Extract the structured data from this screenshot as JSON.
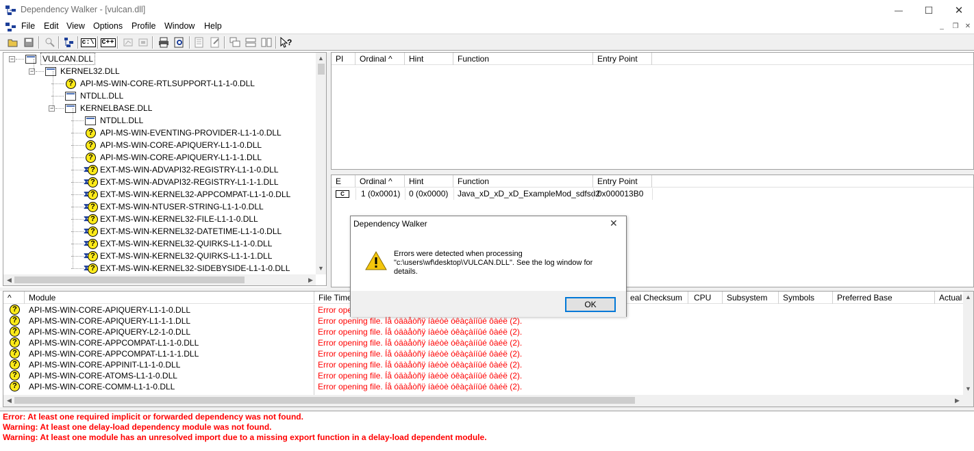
{
  "window": {
    "title": "Dependency Walker - [vulcan.dll]",
    "minimize": "—",
    "maximize": "☐",
    "close": "✕"
  },
  "menu": {
    "items": [
      "File",
      "Edit",
      "View",
      "Options",
      "Profile",
      "Window",
      "Help"
    ],
    "mdi_minimize": "_",
    "mdi_restore": "❐",
    "mdi_close": "✕"
  },
  "toolbar": {
    "c_label": "c:\\",
    "cpp_label": "C++"
  },
  "tree": {
    "items": [
      {
        "label": "VULCAN.DLL",
        "icon": "dll-module-icon",
        "level": 0,
        "selected": true
      },
      {
        "label": "KERNEL32.DLL",
        "icon": "dll-module-icon",
        "level": 1
      },
      {
        "label": "API-MS-WIN-CORE-RTLSUPPORT-L1-1-0.DLL",
        "icon": "missing-module-icon",
        "level": 2
      },
      {
        "label": "NTDLL.DLL",
        "icon": "dll-module-icon",
        "level": 2
      },
      {
        "label": "KERNELBASE.DLL",
        "icon": "dll-module-icon",
        "level": 2
      },
      {
        "label": "NTDLL.DLL",
        "icon": "dll-module-icon",
        "level": 3
      },
      {
        "label": "API-MS-WIN-EVENTING-PROVIDER-L1-1-0.DLL",
        "icon": "missing-module-icon",
        "level": 3
      },
      {
        "label": "API-MS-WIN-CORE-APIQUERY-L1-1-0.DLL",
        "icon": "missing-module-icon",
        "level": 3
      },
      {
        "label": "API-MS-WIN-CORE-APIQUERY-L1-1-1.DLL",
        "icon": "missing-module-icon",
        "level": 3
      },
      {
        "label": "EXT-MS-WIN-ADVAPI32-REGISTRY-L1-1-0.DLL",
        "icon": "delay-load-missing-icon",
        "level": 3
      },
      {
        "label": "EXT-MS-WIN-ADVAPI32-REGISTRY-L1-1-1.DLL",
        "icon": "delay-load-missing-icon",
        "level": 3
      },
      {
        "label": "EXT-MS-WIN-KERNEL32-APPCOMPAT-L1-1-0.DLL",
        "icon": "delay-load-missing-icon",
        "level": 3
      },
      {
        "label": "EXT-MS-WIN-NTUSER-STRING-L1-1-0.DLL",
        "icon": "delay-load-missing-icon",
        "level": 3
      },
      {
        "label": "EXT-MS-WIN-KERNEL32-FILE-L1-1-0.DLL",
        "icon": "delay-load-missing-icon",
        "level": 3
      },
      {
        "label": "EXT-MS-WIN-KERNEL32-DATETIME-L1-1-0.DLL",
        "icon": "delay-load-missing-icon",
        "level": 3
      },
      {
        "label": "EXT-MS-WIN-KERNEL32-QUIRKS-L1-1-0.DLL",
        "icon": "delay-load-missing-icon",
        "level": 3
      },
      {
        "label": "EXT-MS-WIN-KERNEL32-QUIRKS-L1-1-1.DLL",
        "icon": "delay-load-missing-icon",
        "level": 3
      },
      {
        "label": "EXT-MS-WIN-KERNEL32-SIDEBYSIDE-L1-1-0.DLL",
        "icon": "delay-load-missing-icon",
        "level": 3
      }
    ]
  },
  "imports_table": {
    "columns": [
      "PI",
      "Ordinal ^",
      "Hint",
      "Function",
      "Entry Point"
    ]
  },
  "exports_table": {
    "columns": [
      "E",
      "Ordinal ^",
      "Hint",
      "Function",
      "Entry Point"
    ],
    "rows": [
      {
        "icon": "C",
        "ordinal": "1 (0x0001)",
        "hint": "0 (0x0000)",
        "function": "Java_xD_xD_xD_ExampleMod_sdfsd2",
        "entry_point": "0x000013B0"
      }
    ]
  },
  "modules_table": {
    "columns": [
      "^",
      "Module",
      "File Time",
      "eal Checksum",
      "CPU",
      "Subsystem",
      "Symbols",
      "Preferred Base",
      "Actual"
    ],
    "rows": [
      {
        "module": "API-MS-WIN-CORE-APIQUERY-L1-1-0.DLL",
        "file_time": "Error ope"
      },
      {
        "module": "API-MS-WIN-CORE-APIQUERY-L1-1-1.DLL",
        "file_time": "Error opening file. Íå óäàåòñÿ íàéòè óêàçàííûé ôàéë (2)."
      },
      {
        "module": "API-MS-WIN-CORE-APIQUERY-L2-1-0.DLL",
        "file_time": "Error opening file. Íå óäàåòñÿ íàéòè óêàçàííûé ôàéë (2)."
      },
      {
        "module": "API-MS-WIN-CORE-APPCOMPAT-L1-1-0.DLL",
        "file_time": "Error opening file. Íå óäàåòñÿ íàéòè óêàçàííûé ôàéë (2)."
      },
      {
        "module": "API-MS-WIN-CORE-APPCOMPAT-L1-1-1.DLL",
        "file_time": "Error opening file. Íå óäàåòñÿ íàéòè óêàçàííûé ôàéë (2)."
      },
      {
        "module": "API-MS-WIN-CORE-APPINIT-L1-1-0.DLL",
        "file_time": "Error opening file. Íå óäàåòñÿ íàéòè óêàçàííûé ôàéë (2)."
      },
      {
        "module": "API-MS-WIN-CORE-ATOMS-L1-1-0.DLL",
        "file_time": "Error opening file. Íå óäàåòñÿ íàéòè óêàçàííûé ôàéë (2)."
      },
      {
        "module": "API-MS-WIN-CORE-COMM-L1-1-0.DLL",
        "file_time": "Error opening file. Íå óäàåòñÿ íàéòè óêàçàííûé ôàéë (2)."
      }
    ]
  },
  "log": {
    "lines": [
      "Error: At least one required implicit or forwarded dependency was not found.",
      "Warning: At least one delay-load dependency module was not found.",
      "Warning: At least one module has an unresolved import due to a missing export function in a delay-load dependent module."
    ]
  },
  "dialog": {
    "title": "Dependency Walker",
    "message_line1": "Errors were detected when processing",
    "message_line2": "\"c:\\users\\wf\\desktop\\VULCAN.DLL\".  See the log window for",
    "message_line3": "details.",
    "ok_label": "OK",
    "close": "✕"
  },
  "colors": {
    "error_text": "#ff0000",
    "question_icon": "#ffeb1a",
    "ok_focus_border": "#0078d7"
  }
}
